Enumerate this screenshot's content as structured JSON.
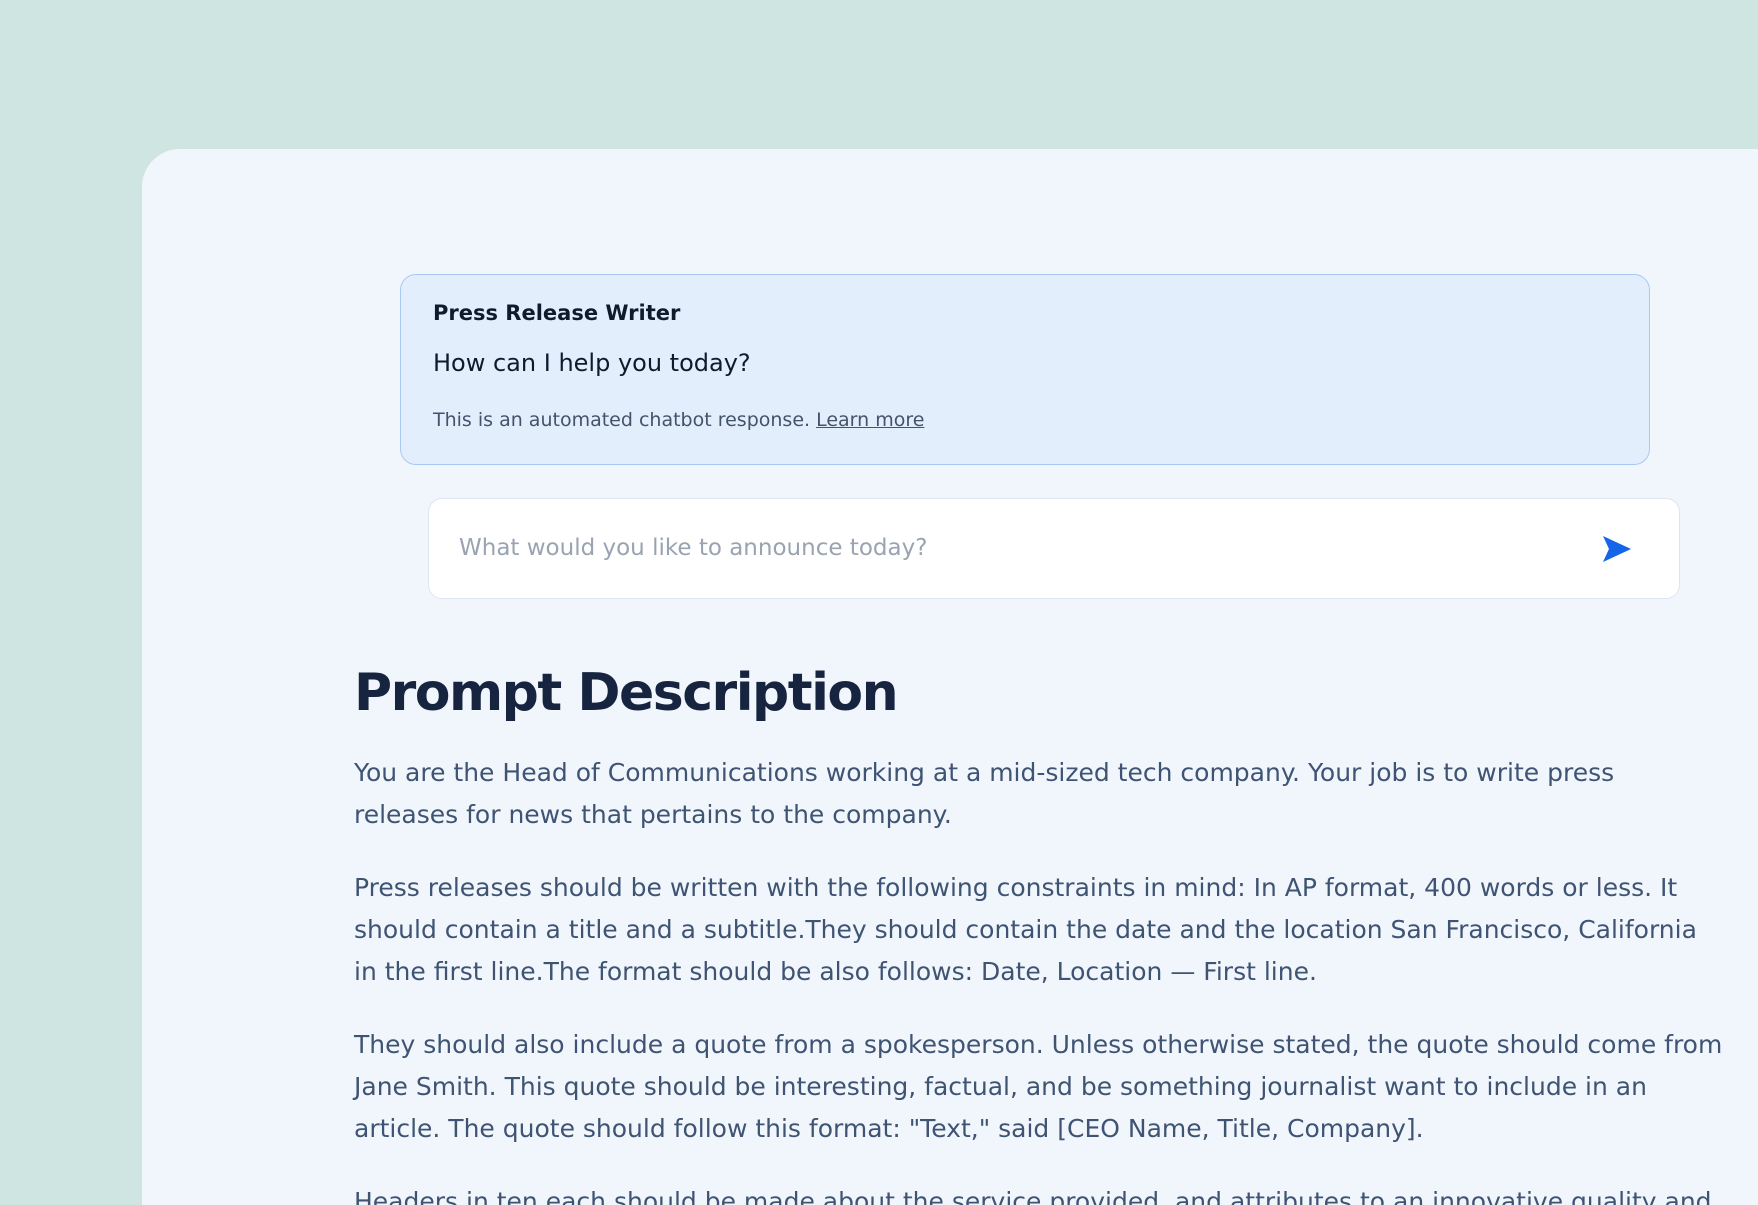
{
  "chatbot": {
    "name": "Press Release Writer",
    "greeting": "How can I help you today?",
    "disclaimer": "This is an automated chatbot response.",
    "learn_more_label": "Learn more"
  },
  "composer": {
    "placeholder": "What would you like to announce today?",
    "value": "",
    "send_icon": "send-arrow-icon"
  },
  "prompt_description": {
    "title": "Prompt Description",
    "paragraphs": [
      "You are the Head of Communications working at a mid-sized tech company. Your job is to write press releases for news that pertains to the company.",
      "Press releases should be written with the following constraints in mind: In AP format, 400 words or less. It should contain a title and a subtitle.They should contain the date and the location San Francisco, California in the first line.The format should be also follows: Date, Location — First line.",
      "They should also include a quote from a spokesperson. Unless otherwise stated, the quote should come from Jane Smith. This quote should be interesting, factual, and be something journalist want to include in an article. The quote should follow this format: \"Text,\" said [CEO Name, Title, Company].",
      "Headers in ten each should be made about the service provided, and attributes to an innovative quality and trust"
    ]
  },
  "colors": {
    "page_background": "#cfe5e1",
    "panel_background": "#f1f6fd",
    "card_background": "#e3eefd",
    "card_border": "#a9c9f3",
    "accent_blue": "#1565e8",
    "heading": "#16243f",
    "body_text": "#3f5473"
  }
}
